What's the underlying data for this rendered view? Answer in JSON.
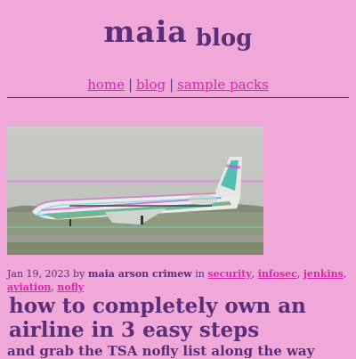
{
  "header": {
    "site_name": "maia",
    "site_sub": "blog"
  },
  "nav": {
    "items": [
      {
        "label": "home"
      },
      {
        "label": "blog"
      },
      {
        "label": "sample packs"
      }
    ],
    "separator": "|"
  },
  "post": {
    "date": "Jan 19, 2023",
    "by": "by",
    "author": "maia arson crimew",
    "in": "in",
    "tags": [
      "security",
      "infosec",
      "jenkins",
      "aviation",
      "nofly"
    ],
    "tag_sep": ",",
    "title": "how to completely own an airline in 3 easy steps",
    "subtitle": "and grab the TSA nofly list along the way"
  },
  "colors": {
    "background": "#f0a8d8",
    "text": "#5a2e78",
    "link": "#d628a8"
  }
}
